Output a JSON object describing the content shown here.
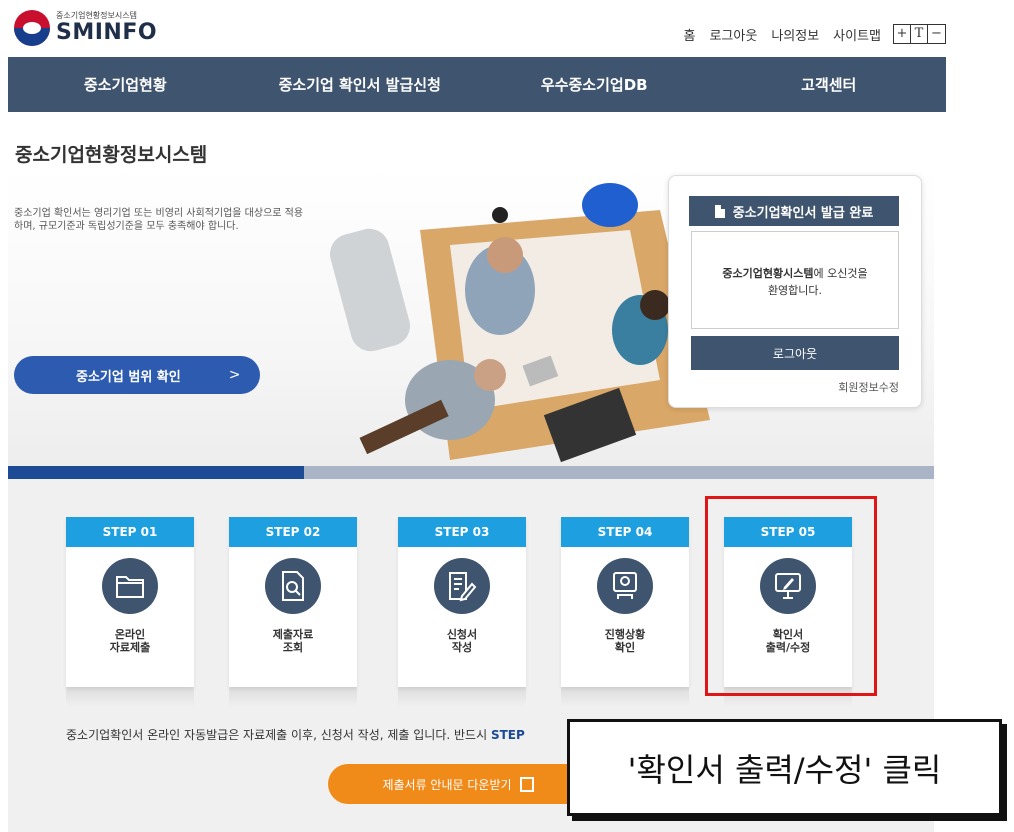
{
  "header": {
    "logo_sub": "중소기업현황정보시스템",
    "logo_main": "SMINFO",
    "util_links": [
      "홈",
      "로그아웃",
      "나의정보",
      "사이트맵"
    ],
    "font_controls": [
      "+",
      "T",
      "−"
    ]
  },
  "nav": {
    "items": [
      "중소기업현황",
      "중소기업 확인서 발급신청",
      "우수중소기업DB",
      "고객센터"
    ]
  },
  "hero": {
    "page_title": "중소기업현황정보시스템",
    "description": "중소기업 확인서는 영리기업 또는 비영리 사회적기업을 대상으로 적용하며, 규모기준과 독립성기준을 모두 충족해야 합니다.",
    "range_button": "중소기업 범위 확인",
    "range_arrow": ">",
    "progress": 0.32
  },
  "login_box": {
    "title": "중소기업확인서 발급 완료",
    "welcome_bold": "중소기업현황시스템",
    "welcome_rest": "에 오신것을",
    "welcome_line2": "환영합니다.",
    "logout_button": "로그아웃",
    "member_edit": "회원정보수정"
  },
  "steps": [
    {
      "step": "STEP 01",
      "label": "온라인\n자료제출",
      "icon": "folder-icon"
    },
    {
      "step": "STEP 02",
      "label": "제출자료\n조회",
      "icon": "document-search-icon"
    },
    {
      "step": "STEP 03",
      "label": "신청서\n작성",
      "icon": "document-edit-icon"
    },
    {
      "step": "STEP 04",
      "label": "진행상황\n확인",
      "icon": "monitor-person-icon"
    },
    {
      "step": "STEP 05",
      "label": "확인서\n출력/수정",
      "icon": "monitor-edit-icon"
    }
  ],
  "notice": {
    "text": "중소기업확인서 온라인 자동발급은 자료제출 이후, 신청서 작성, 제출 입니다. 반드시 ",
    "highlight": "STEP"
  },
  "download_button": "제출서류 안내문 다운받기",
  "callout": "'확인서 출력/수정' 클릭",
  "colors": {
    "nav": "#3f546e",
    "step_head": "#1ea0e0",
    "highlight_border": "#e01515",
    "download": "#f08a18",
    "range_button": "#2d5bb0"
  }
}
